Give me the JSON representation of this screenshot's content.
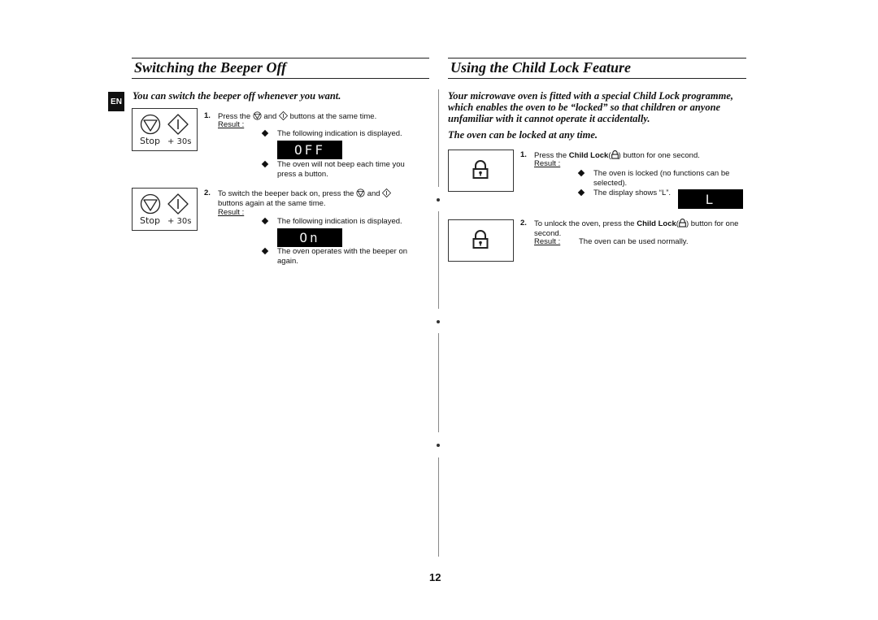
{
  "left": {
    "title": "Switching the Beeper Off",
    "lang_badge": "EN",
    "intro": "You can switch the beeper off whenever you want.",
    "panel_labels": {
      "stop": "Stop",
      "plus30": "+ 30s"
    },
    "steps": [
      {
        "num": "1.",
        "text_before": "Press the",
        "text_mid": "and",
        "text_after": "buttons at the same time.",
        "result_label": "Result :",
        "bullets": [
          "The following indication is displayed.",
          "The oven will not beep each time you press a button."
        ],
        "display": "OFF"
      },
      {
        "num": "2.",
        "text_before": "To switch the beeper back on, press the",
        "text_mid": "and",
        "text_after": "buttons again at the same time.",
        "result_label": "Result :",
        "bullets": [
          "The following indication is displayed.",
          "The oven operates with the beeper on again."
        ],
        "display": "On"
      }
    ]
  },
  "right": {
    "title": "Using the Child Lock Feature",
    "intro": "Your microwave oven is fitted with a special Child Lock programme, which enables the oven to be “locked” so that children or anyone unfamiliar with it cannot operate it accidentally.",
    "intro2": "The oven can be locked at any time.",
    "steps": [
      {
        "num": "1.",
        "text_before": "Press the",
        "bold": "Child Lock",
        "text_after": "button for one second.",
        "result_label": "Result :",
        "bullets": [
          "The oven is locked (no functions can be selected).",
          "The display shows “L”."
        ],
        "display": "L"
      },
      {
        "num": "2.",
        "text_before": "To unlock the oven, press the",
        "bold": "Child Lock",
        "text_after": "button for one second.",
        "result_label": "Result :",
        "result_text": "The oven can be used normally."
      }
    ]
  },
  "page_number": "12"
}
